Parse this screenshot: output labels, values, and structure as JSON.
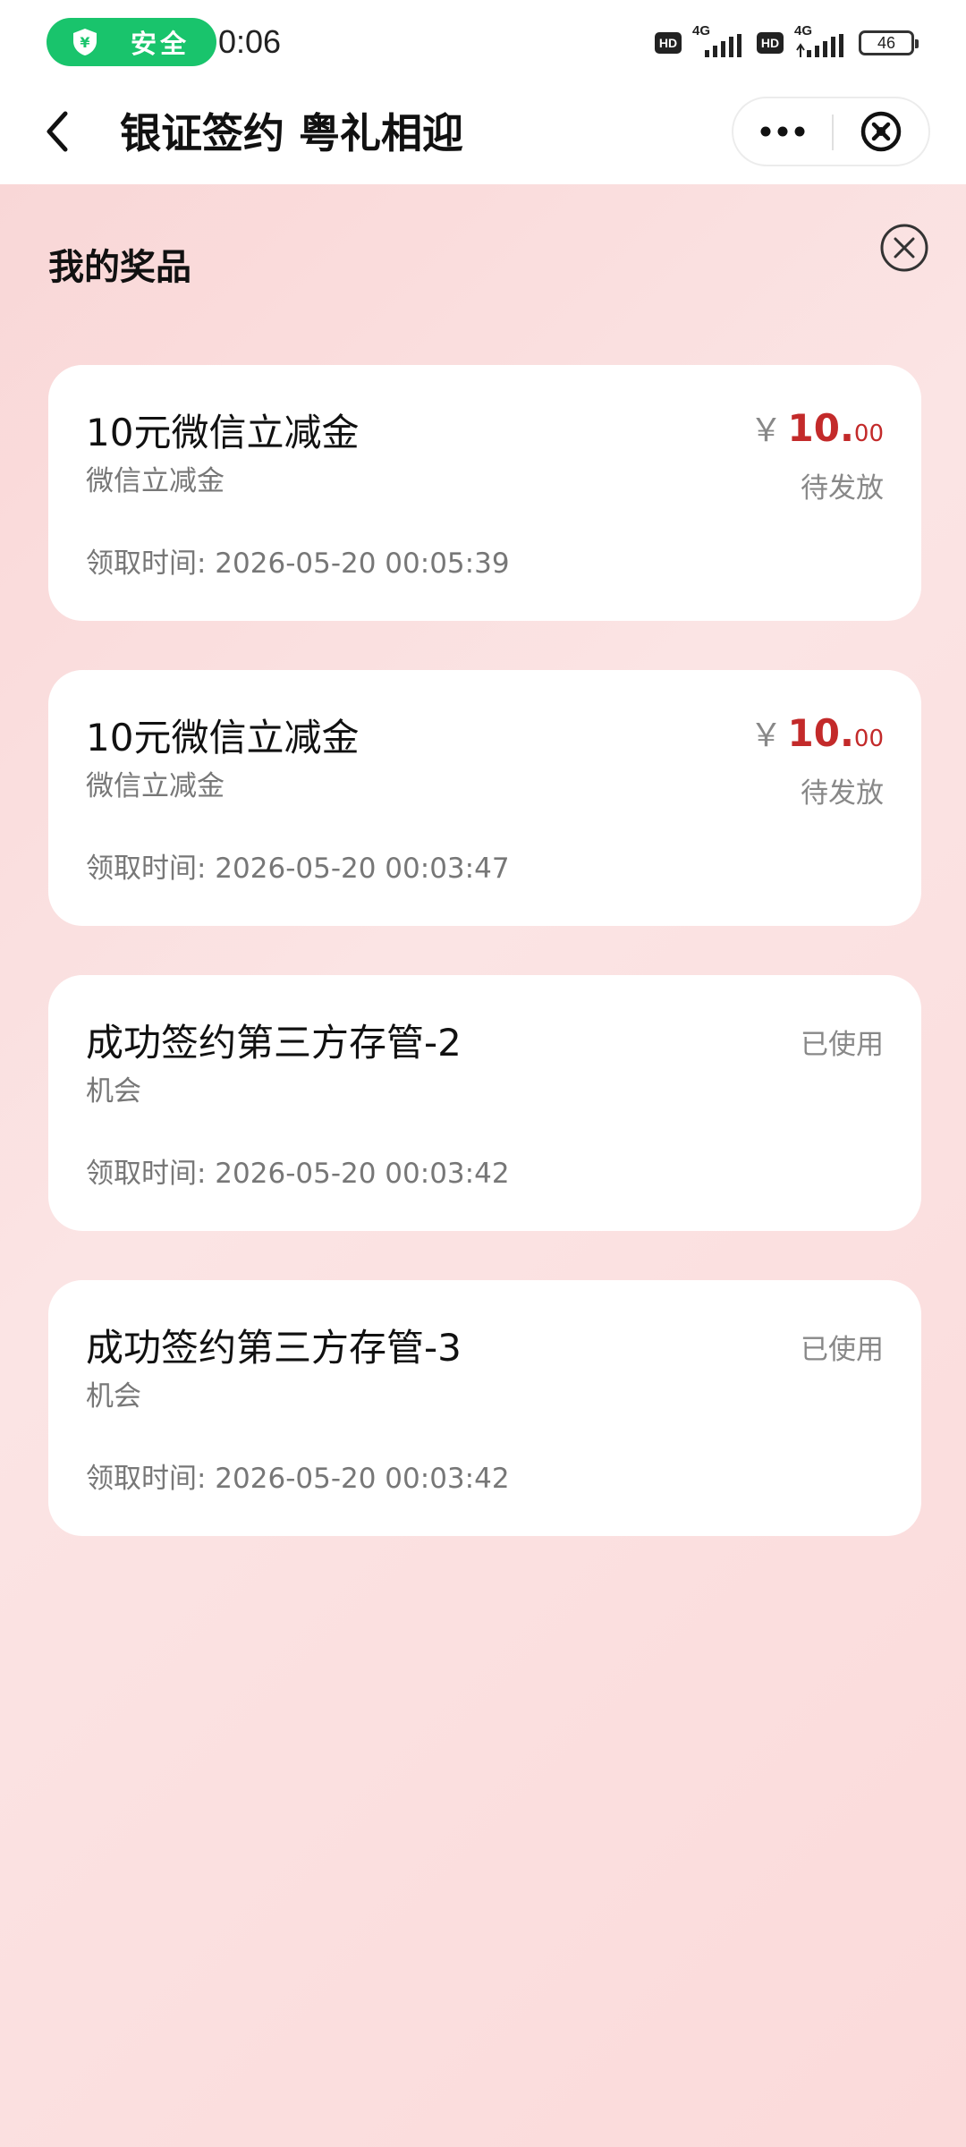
{
  "status_bar": {
    "security_label": "安全",
    "clock": "0:06",
    "network1_hd": "HD",
    "network1_gen": "4G",
    "network2_hd": "HD",
    "network2_gen": "4G",
    "battery": "46"
  },
  "nav": {
    "title": "银证签约 粤礼相迎",
    "icons": [
      "chevron-left-icon",
      "more-dots-icon",
      "close-circle-icon"
    ]
  },
  "panel": {
    "title": "我的奖品"
  },
  "prizes": [
    {
      "name": "10元微信立减金",
      "sub": "微信立减金",
      "time": "领取时间: 2026-05-20 00:05:39",
      "currency": "￥",
      "amount_int": "10.",
      "amount_dec": "00",
      "status": "待发放"
    },
    {
      "name": "10元微信立减金",
      "sub": "微信立减金",
      "time": "领取时间: 2026-05-20 00:03:47",
      "currency": "￥",
      "amount_int": "10.",
      "amount_dec": "00",
      "status": "待发放"
    },
    {
      "name": "成功签约第三方存管-2",
      "sub": "机会",
      "time": "领取时间: 2026-05-20 00:03:42",
      "status": "已使用"
    },
    {
      "name": "成功签约第三方存管-3",
      "sub": "机会",
      "time": "领取时间: 2026-05-20 00:03:42",
      "status": "已使用"
    }
  ],
  "colors": {
    "security_green": "#19c46c",
    "price_red": "#c32a2a",
    "background_pink": "#fbe1e1"
  }
}
